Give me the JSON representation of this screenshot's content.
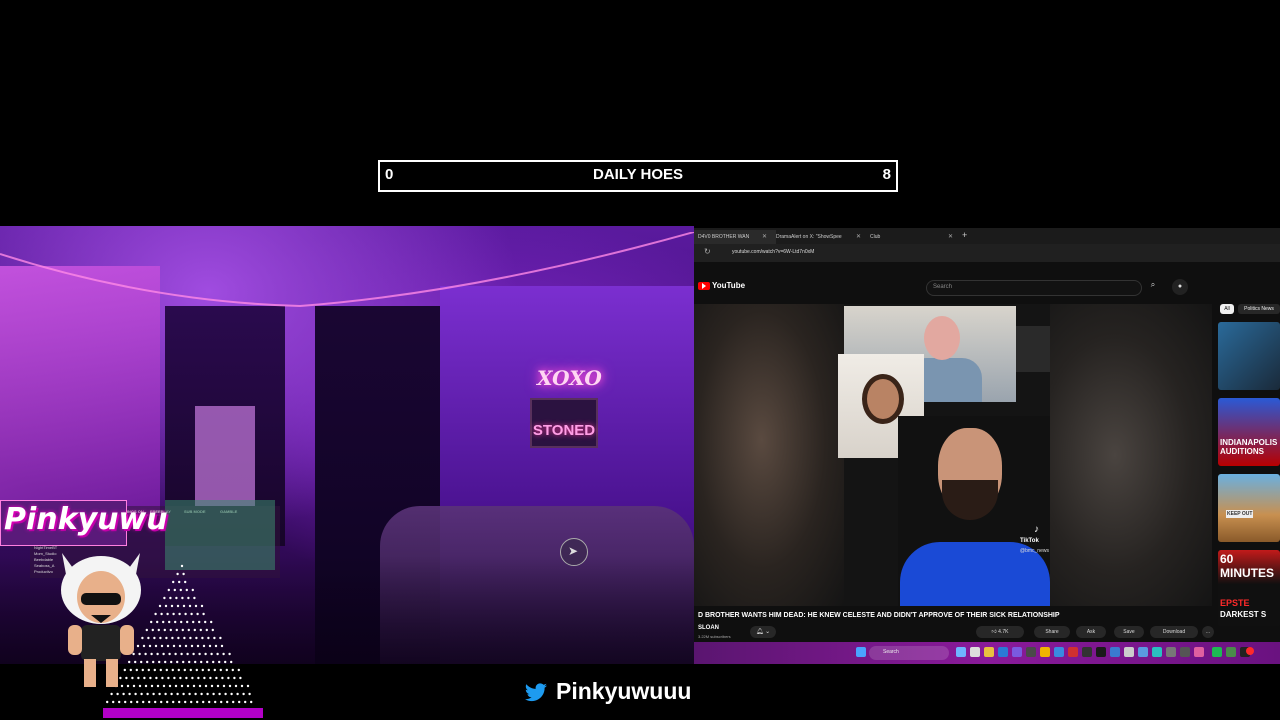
{
  "scorebar": {
    "left_score": "0",
    "title": "DAILY HOES",
    "right_score": "8"
  },
  "stream_overlay": {
    "logo_text": "Pinkyuwu",
    "neon_xoxo": "XOXO",
    "neon_stoned": "STONED",
    "stats_headers": [
      "KINGS ON",
      "FREEPLAY",
      "SUB MODE",
      "GAMBLE"
    ],
    "stats_rows": [
      "Chrxmxsi",
      "NightTimeBT",
      "Mom_Studio",
      "Beebdable",
      "Seaboss_A",
      "Productivo"
    ]
  },
  "browser": {
    "tabs": [
      {
        "label": "D4V0 BROTHER WAN"
      },
      {
        "label": "DramaAlert on X: \"ShowSpee"
      },
      {
        "label": "Club"
      }
    ],
    "new_tab": "+",
    "url": "youtube.com/watch?v=6W-Ltd7n0xM",
    "youtube": {
      "brand": "YouTube",
      "search_placeholder": "Search",
      "video_title": "D BROTHER WANTS HIM DEAD: HE KNEW CELESTE AND DIDN'T APPROVE OF THEIR SICK RELATIONSHIP",
      "channel": "SLOAN",
      "subscribers": "3.22M subscribers",
      "tiktok_label": "TikTok",
      "tiktok_handle": "@bmc_news",
      "actions": {
        "like": "4.7K",
        "share": "Share",
        "ask": "Ask",
        "save": "Save",
        "download": "Download",
        "more": "..."
      },
      "chips": [
        "All",
        "Politics News"
      ],
      "sidebar_thumbs": [
        {
          "text": ""
        },
        {
          "text": "INDIANAPOLIS AUDITIONS"
        },
        {
          "text": "KEEP OUT"
        },
        {
          "text_top": "60 MINUTES",
          "text_a": "EPSTE",
          "text_b": "DARKEST S"
        }
      ]
    },
    "taskbar": {
      "search_label": "Search"
    }
  },
  "footer": {
    "twitter_handle": "Pinkyuwuuu"
  },
  "colors": {
    "accent_pink": "#b300c8",
    "youtube_red": "#ff0000",
    "twitter_blue": "#1d9bf0"
  }
}
